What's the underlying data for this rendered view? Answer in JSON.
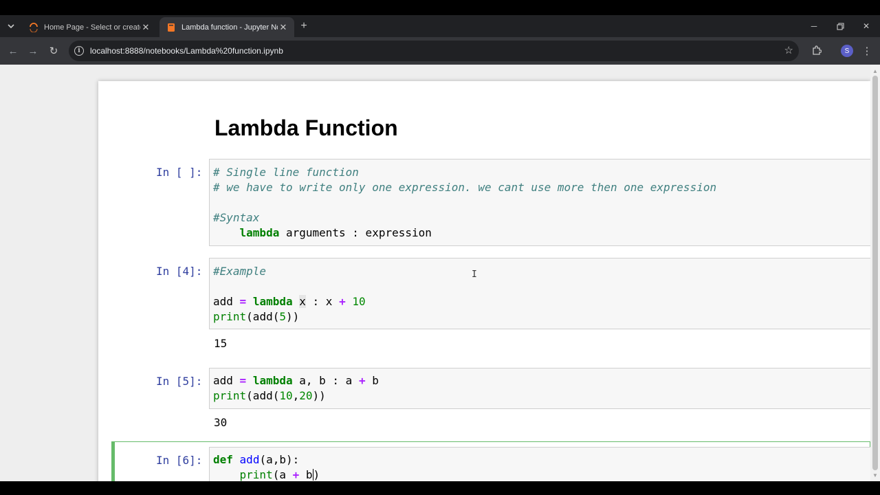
{
  "browser": {
    "tabs": [
      {
        "title": "Home Page - Select or create a notebook",
        "active": false
      },
      {
        "title": "Lambda function - Jupyter Notebook",
        "active": true
      }
    ],
    "url": "localhost:8888/notebooks/Lambda%20function.ipynb",
    "profile_initial": "S",
    "colors": {
      "tabstrip": "#202124",
      "toolbar": "#35363a",
      "avatar": "#5b5fc7"
    }
  },
  "notebook": {
    "heading": "Lambda Function",
    "cells": [
      {
        "prompt": "In [ ]:",
        "lines": [
          "# Single line function",
          "# we have to write only one expression. we cant use more then one expression",
          "",
          "#Syntax",
          "    lambda arguments : expression"
        ]
      },
      {
        "prompt": "In [4]:",
        "lines": [
          "#Example",
          "",
          "add = lambda x : x + 10",
          "print(add(5))"
        ],
        "output": "15"
      },
      {
        "prompt": "In [5]:",
        "lines": [
          "add = lambda a, b : a + b",
          "print(add(10,20))"
        ],
        "output": "30"
      },
      {
        "prompt": "In [6]:",
        "lines": [
          "def add(a,b):",
          "    print(a + b)"
        ],
        "selected": true
      }
    ],
    "colors": {
      "prompt": "#303f9f",
      "comment": "#408080",
      "keyword": "#008000",
      "operator": "#aa22ff",
      "selected_border": "#66bb6a"
    }
  }
}
